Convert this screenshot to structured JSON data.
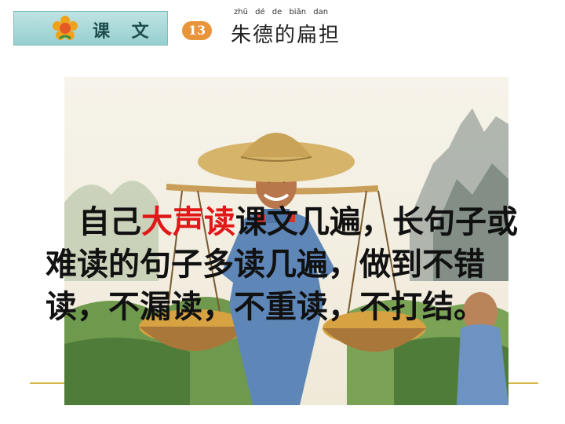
{
  "header": {
    "tag_label": "课 文",
    "lesson_number": "13",
    "pinyin": "zhū dé de biǎn dan",
    "title": "朱德的扁担"
  },
  "body": {
    "before": "自己",
    "highlight": "大声读",
    "after": "课文几遍，长句子或难读的句子多读几遍，做到不错读，不漏读，不重读，不打结。"
  },
  "colors": {
    "highlight": "#e01818",
    "tag_bg": "#97cfcf",
    "number_badge": "#e8943a"
  }
}
